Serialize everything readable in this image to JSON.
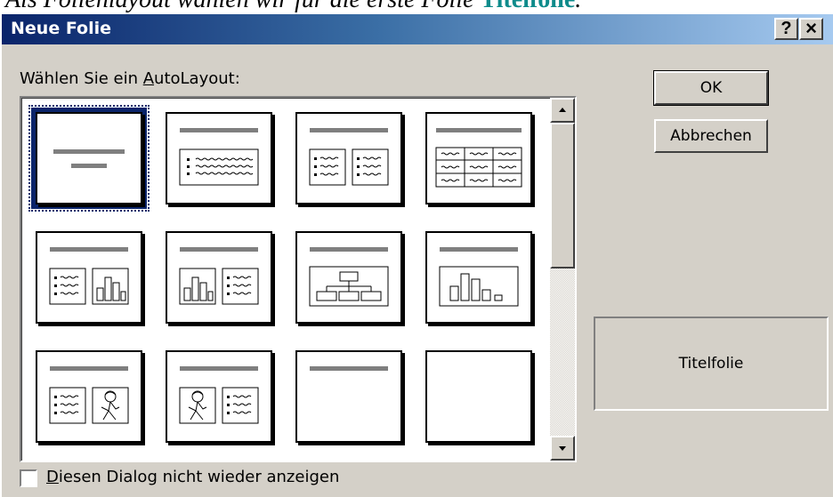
{
  "document": {
    "text_before": "Als Folienlayout wählen wir für die erste Folie ",
    "highlight": "Titelfolie",
    "text_after": "."
  },
  "dialog": {
    "title": "Neue Folie",
    "help_label": "?",
    "close_label": "×",
    "autolayout_label_pre": "Wählen Sie ein ",
    "autolayout_label_accel": "A",
    "autolayout_label_post": "utoLayout:",
    "ok_label": "OK",
    "cancel_label": "Abbrechen",
    "preview_label": "Titelfolie",
    "checkbox_label_accel": "D",
    "checkbox_label_rest": "iesen Dialog nicht wieder anzeigen",
    "checkbox_checked": false,
    "selected_layout": "Titelfolie",
    "layouts": [
      {
        "icon": "title-slide-icon"
      },
      {
        "icon": "bulleted-list-icon"
      },
      {
        "icon": "two-column-text-icon"
      },
      {
        "icon": "table-icon"
      },
      {
        "icon": "text-and-chart-icon"
      },
      {
        "icon": "chart-and-text-icon"
      },
      {
        "icon": "organization-chart-icon"
      },
      {
        "icon": "chart-icon"
      },
      {
        "icon": "text-and-clipart-icon"
      },
      {
        "icon": "clipart-and-text-icon"
      },
      {
        "icon": "title-only-icon"
      },
      {
        "icon": "blank-icon"
      }
    ]
  },
  "colors": {
    "dialog_face": "#d4d0c8",
    "title_gradient_start": "#0a246a",
    "title_gradient_end": "#a6caf0",
    "highlight_text": "#0e8b8b",
    "placeholder_bar": "#7f7f7f"
  }
}
